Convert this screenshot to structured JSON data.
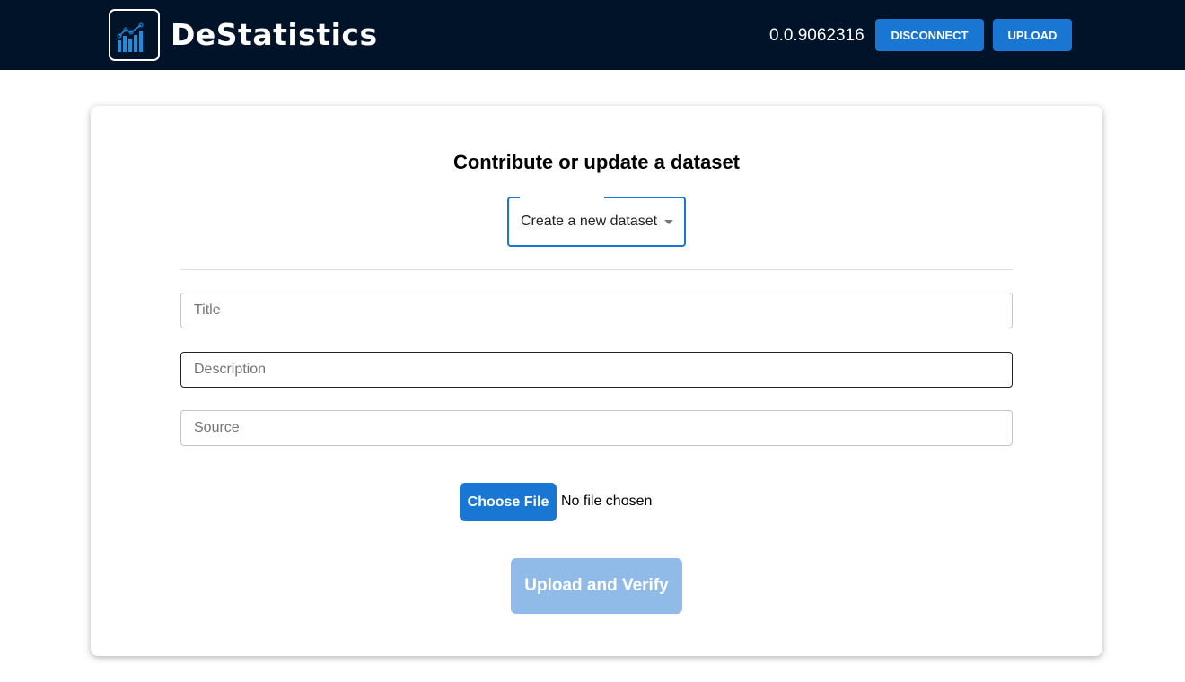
{
  "header": {
    "brand": "DeStatistics",
    "balance": "0.0.9062316",
    "disconnect_label": "DISCONNECT",
    "upload_label": "UPLOAD",
    "logo_icon": "chart-logo-icon"
  },
  "form": {
    "title": "Contribute or update a dataset",
    "dataset_select": "Create a new dataset",
    "title_placeholder": "Title",
    "description_placeholder": "Description",
    "source_placeholder": "Source",
    "choose_file_label": "Choose File",
    "file_status": "No file chosen",
    "submit_label": "Upload and Verify"
  },
  "colors": {
    "header_bg": "#001329",
    "accent": "#1976d2",
    "disabled_button": "#90bbe9"
  }
}
